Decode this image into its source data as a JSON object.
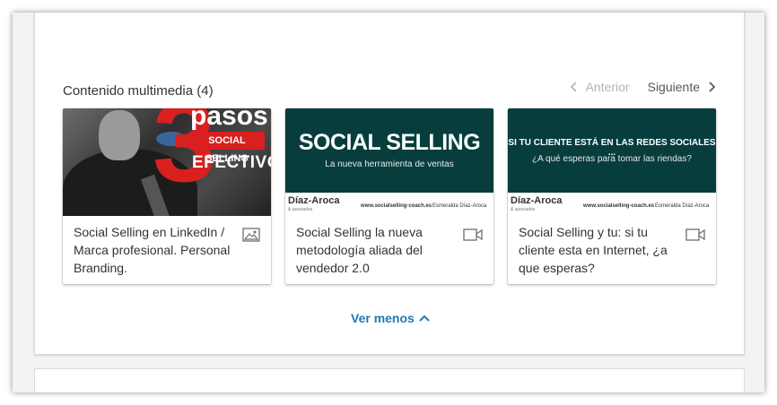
{
  "section": {
    "title": "Contenido multimedia (4)",
    "pager": {
      "prev_label": "Anterior",
      "next_label": "Siguiente"
    },
    "more_label": "Ver menos",
    "link_color": "#1f79b5"
  },
  "items": [
    {
      "caption": "Social Selling en LinkedIn / Marca profesional. Personal Branding.",
      "type_icon": "image-icon",
      "thumb": {
        "big_number": "3",
        "word": "pasos",
        "band": "SOCIAL SELLING",
        "line": "EFECTIVO"
      }
    },
    {
      "caption": "Social Selling la nueva metodología aliada del vendedor 2.0",
      "type_icon": "video-icon",
      "thumb": {
        "headline": "SOCIAL SELLING",
        "subtitle": "La nueva herramienta de ventas",
        "logo": "Díaz-Aroca",
        "logo_tag": "& asociados",
        "url": "www.socialselling-coach.es",
        "author": "Esmeralda Díaz-Aroca"
      }
    },
    {
      "caption": "Social Selling y tu: si tu cliente esta en Internet, ¿a que esperas?",
      "type_icon": "video-icon",
      "thumb": {
        "headline": "SI TU CLIENTE ESTÁ EN LAS REDES SOCIALES ...",
        "subtitle": "¿A qué esperas para tomar las riendas?",
        "logo": "Díaz-Aroca",
        "logo_tag": "& asociados",
        "url": "www.socialselling-coach.es",
        "author": "Esmeralda Díaz-Aroca"
      }
    }
  ]
}
